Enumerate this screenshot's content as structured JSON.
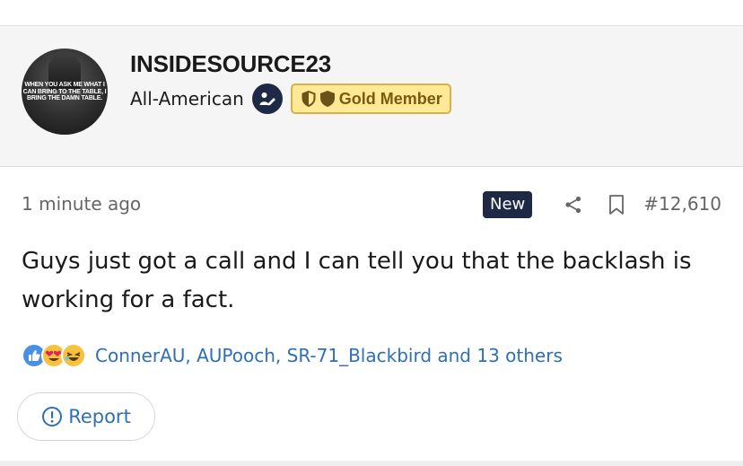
{
  "user": {
    "username": "INSIDESOURCE23",
    "role": "All-American",
    "badge_label": "Gold Member",
    "avatar_quote": "WHEN YOU ASK ME WHAT I CAN BRING TO THE TABLE, I BRING THE DAMN TABLE.",
    "role_icon": "pen-user-icon",
    "badge_icons": [
      "shield-half-icon",
      "shield-icon"
    ]
  },
  "post": {
    "time_ago": "1 minute ago",
    "new_label": "New",
    "post_number": "#12,610",
    "body": "Guys just got a call and I can tell you that the backlash is working for a fact."
  },
  "reactions": {
    "icons": [
      "like-icon",
      "heart-eyes-icon",
      "laughing-icon"
    ],
    "names": "ConnerAU, AUPooch, SR-71_Blackbird and 13 others"
  },
  "actions": {
    "report_label": "Report"
  },
  "colors": {
    "navy": "#1e2a45",
    "gold_bg": "#ffe896",
    "gold_border": "#d6b14a",
    "link_blue": "#2f6fb6"
  }
}
